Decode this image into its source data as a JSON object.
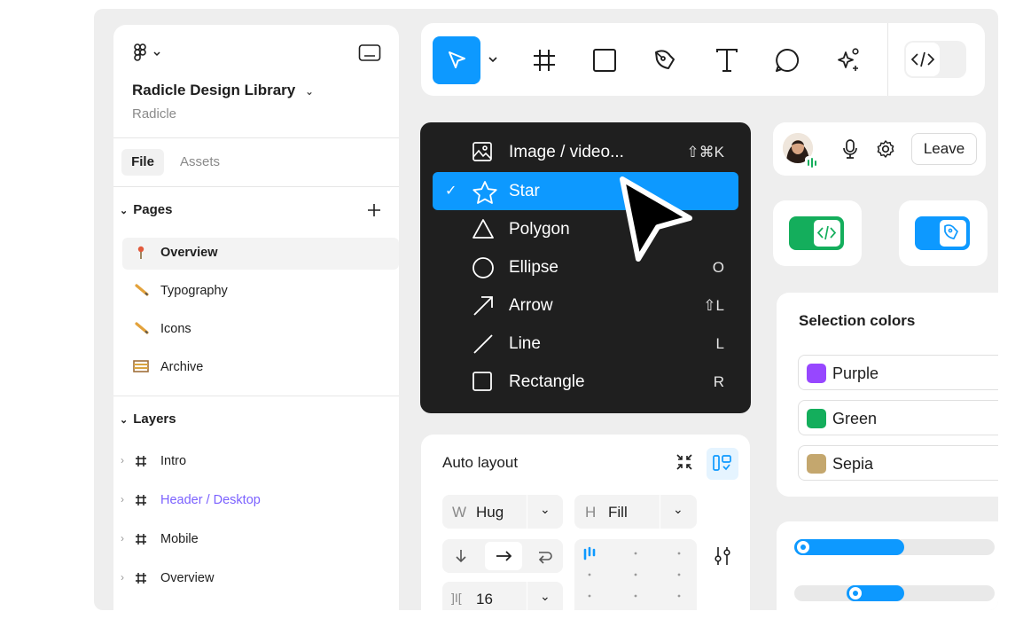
{
  "file": {
    "menu_icon": "figma-logo-icon",
    "title": "Radicle Design Library",
    "team": "Radicle",
    "tabs": [
      "File",
      "Assets"
    ]
  },
  "pages": {
    "label": "Pages",
    "items": [
      {
        "label": "Overview",
        "icon": "pin-icon",
        "selected": true
      },
      {
        "label": "Typography",
        "icon": "pencil-icon"
      },
      {
        "label": "Icons",
        "icon": "pencil-icon"
      },
      {
        "label": "Archive",
        "icon": "abacus-icon"
      }
    ]
  },
  "layers": {
    "label": "Layers",
    "items": [
      {
        "label": "Intro",
        "icon": "frame-icon"
      },
      {
        "label": "Header / Desktop",
        "icon": "frame-icon",
        "color": "#7b61ff"
      },
      {
        "label": "Mobile",
        "icon": "frame-icon"
      },
      {
        "label": "Overview",
        "icon": "frame-icon"
      }
    ]
  },
  "toolbar": {
    "tools": [
      "move-tool-icon",
      "frame-tool-icon",
      "rectangle-tool-icon",
      "pen-tool-icon",
      "text-tool-icon",
      "comment-tool-icon",
      "actions-tool-icon"
    ],
    "dev_mode": "code-icon"
  },
  "shape_menu": {
    "items": [
      {
        "label": "Image / video...",
        "shortcut": "⇧⌘K",
        "icon": "image-icon"
      },
      {
        "label": "Star",
        "shortcut": "",
        "icon": "star-icon",
        "selected": true
      },
      {
        "label": "Polygon",
        "shortcut": "",
        "icon": "triangle-icon"
      },
      {
        "label": "Ellipse",
        "shortcut": "O",
        "icon": "circle-icon"
      },
      {
        "label": "Arrow",
        "shortcut": "⇧L",
        "icon": "arrow-icon"
      },
      {
        "label": "Line",
        "shortcut": "L",
        "icon": "line-icon"
      },
      {
        "label": "Rectangle",
        "shortcut": "R",
        "icon": "square-icon"
      }
    ]
  },
  "collab": {
    "leave": "Leave"
  },
  "auto_layout": {
    "title": "Auto layout",
    "w_prefix": "W",
    "w_value": "Hug",
    "h_prefix": "H",
    "h_value": "Fill",
    "gap_value": "16"
  },
  "selection_colors": {
    "title": "Selection colors",
    "items": [
      {
        "name": "Purple",
        "color": "#9747ff"
      },
      {
        "name": "Green",
        "color": "#14ae5c"
      },
      {
        "name": "Sepia",
        "color": "#c4a76e"
      }
    ]
  },
  "sliders": [
    {
      "value": 0.55
    },
    {
      "value": 0.55,
      "start": 0.26
    }
  ],
  "accent": "#0d99ff"
}
